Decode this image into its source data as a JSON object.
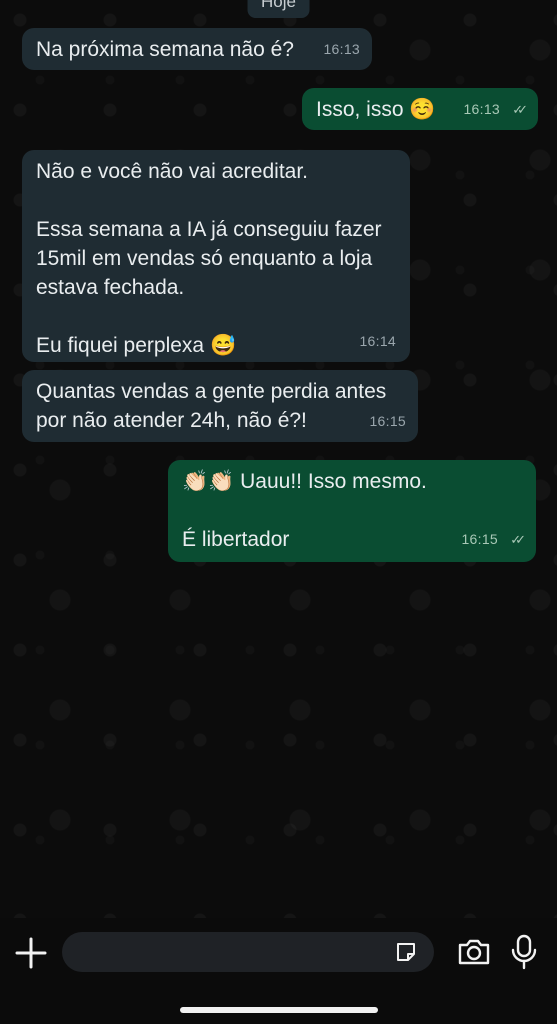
{
  "header": {
    "date_chip": "Hoje"
  },
  "messages": [
    {
      "direction": "in",
      "text": "Na próxima semana não é?",
      "time": "16:13"
    },
    {
      "direction": "out",
      "text": "Isso, isso ☺️",
      "time": "16:13",
      "status": "read"
    },
    {
      "direction": "in",
      "text": "Não e você não vai acreditar.\n\nEssa semana a IA já conseguiu fazer\n15mil em vendas só enquanto a loja\nestava fechada.\n\nEu fiquei perplexa 😅",
      "time": "16:14"
    },
    {
      "direction": "in",
      "text": "Quantas vendas a gente perdia antes\npor não atender 24h, não é?!",
      "time": "16:15"
    },
    {
      "direction": "out",
      "text": "👏🏻👏🏻 Uauu!! Isso mesmo.\n\nÉ libertador",
      "time": "16:15",
      "status": "read"
    }
  ],
  "composer": {
    "placeholder": "",
    "icons": [
      "plus-icon",
      "sticker-icon",
      "camera-icon",
      "mic-icon"
    ]
  },
  "colors": {
    "incoming_bubble": "#1f2c33",
    "outgoing_bubble": "#0a4d32",
    "background": "#0c0c0c"
  }
}
